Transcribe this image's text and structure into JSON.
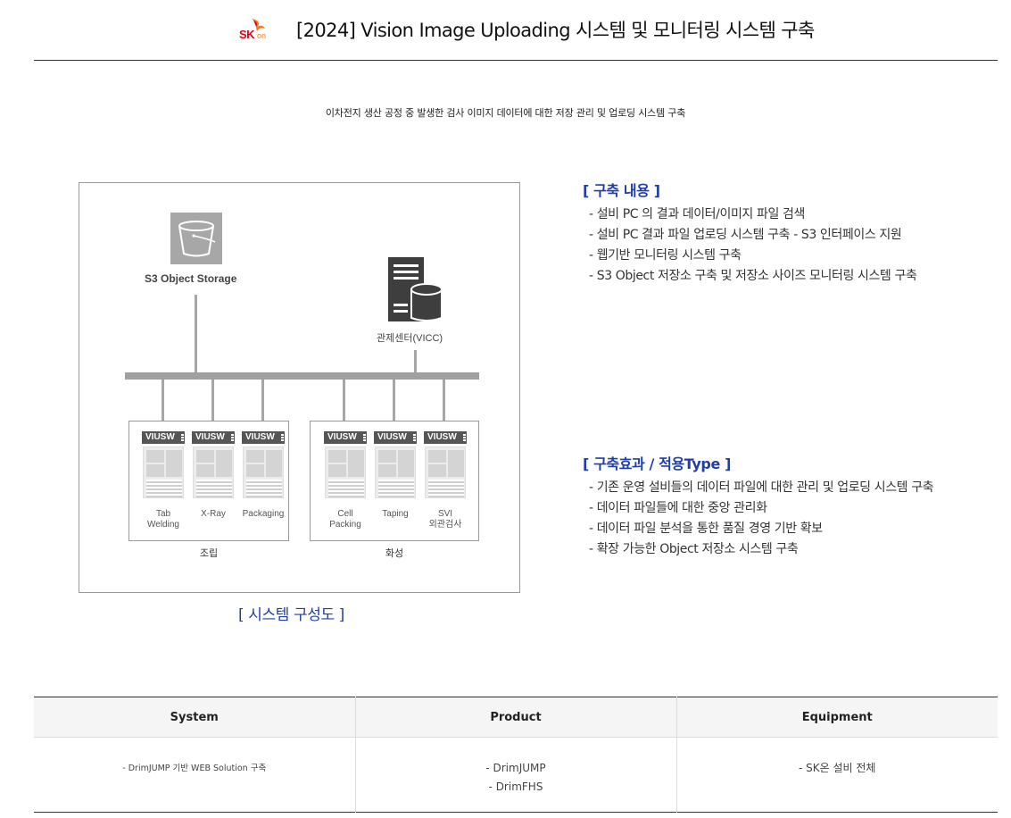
{
  "header": {
    "logo_text": "SK on",
    "logo_mark": "SK",
    "logo_sub": "on",
    "title": "[2024] Vision Image Uploading 시스템 및 모니터링 시스템 구축"
  },
  "subtitle": "이차전지 생산 공정 중 발생한 검사 이미지 데이터에 대한 저장 관리 및 업로딩 시스템 구축",
  "diagram": {
    "storage_label": "S3 Object Storage",
    "control_center_label": "관제센터(VICC)",
    "groups": [
      {
        "label": "조립",
        "units": [
          {
            "tag": "VIUSW",
            "label_lines": [
              "Tab",
              "Welding"
            ]
          },
          {
            "tag": "VIUSW",
            "label_lines": [
              "X-Ray"
            ]
          },
          {
            "tag": "VIUSW",
            "label_lines": [
              "Packaging"
            ]
          }
        ]
      },
      {
        "label": "화성",
        "units": [
          {
            "tag": "VIUSW",
            "label_lines": [
              "Cell",
              "Packing"
            ]
          },
          {
            "tag": "VIUSW",
            "label_lines": [
              "Taping"
            ]
          },
          {
            "tag": "VIUSW",
            "label_lines": [
              "SVI",
              "외관검사"
            ]
          }
        ]
      }
    ],
    "caption": "[ 시스템 구성도 ]",
    "icons": {
      "storage": "bucket-icon",
      "control_center": "server-database-icon",
      "unit": "equipment-cabinet-icon"
    }
  },
  "content": {
    "title": "[ 구축 내용 ]",
    "items": [
      "- 설비 PC 의 결과 데이터/이미지 파일 검색",
      "- 설비 PC 결과 파일 업로딩 시스템 구축  -  S3 인터페이스 지원",
      "- 웹기반 모니터링 시스템 구축",
      "- S3 Object 저장소 구축 및 저장소 사이즈 모니터링 시스템 구축"
    ]
  },
  "effects": {
    "title": "[ 구축효과 / 적용Type ]",
    "items": [
      "- 기존 운영 설비들의 데이터 파일에 대한 관리 및 업로딩 시스템 구축",
      "- 데이터 파일들에 대한 중앙 관리화",
      "- 데이터 파일 분석을 통한 품질 경영 기반 확보",
      "- 확장 가능한 Object 저장소 시스템 구축"
    ]
  },
  "table": {
    "headers": [
      "System",
      "Product",
      "Equipment"
    ],
    "system": [
      "- DrimJUMP 기반 WEB Solution 구축"
    ],
    "product": [
      "- DrimJUMP",
      "- DrimFHS"
    ],
    "equipment": [
      "- SK온 설비 전체"
    ]
  },
  "colors": {
    "accent_blue": "#1f3ea8",
    "logo_red": "#e2001a",
    "logo_orange": "#f47a20",
    "diagram_gray": "#555555"
  }
}
